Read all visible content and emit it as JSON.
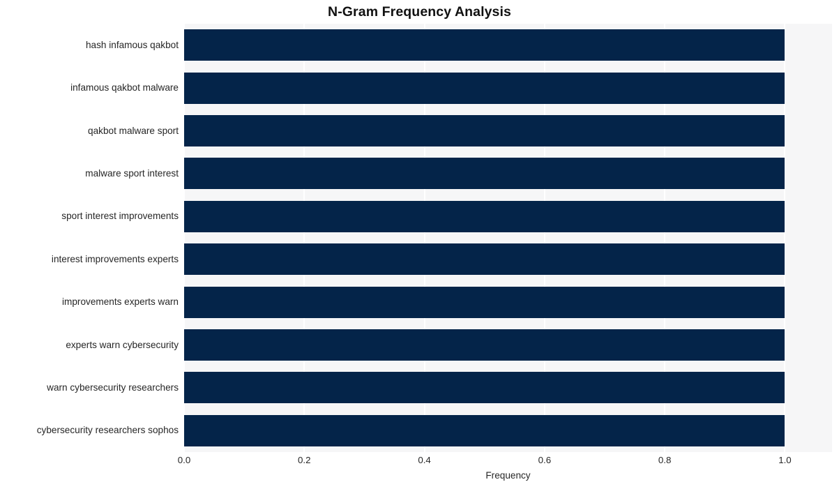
{
  "chart_data": {
    "type": "bar",
    "orientation": "horizontal",
    "title": "N-Gram Frequency Analysis",
    "xlabel": "Frequency",
    "ylabel": "",
    "categories": [
      "hash infamous qakbot",
      "infamous qakbot malware",
      "qakbot malware sport",
      "malware sport interest",
      "sport interest improvements",
      "interest improvements experts",
      "improvements experts warn",
      "experts warn cybersecurity",
      "warn cybersecurity researchers",
      "cybersecurity researchers sophos"
    ],
    "values": [
      1.0,
      1.0,
      1.0,
      1.0,
      1.0,
      1.0,
      1.0,
      1.0,
      1.0,
      1.0
    ],
    "xlim": [
      0.0,
      1.0784
    ],
    "xticks": [
      0.0,
      0.2,
      0.4,
      0.6,
      0.8,
      1.0
    ],
    "xtick_labels": [
      "0.0",
      "0.2",
      "0.4",
      "0.6",
      "0.8",
      "1.0"
    ],
    "grid": true,
    "grid_axis": "x",
    "legend": false,
    "colors": {
      "bar": "#042449",
      "plot_background": "#f6f6f7",
      "figure_background": "#ffffff",
      "gridline": "#ffffff",
      "text": "#262626",
      "title_text": "#111111"
    }
  }
}
